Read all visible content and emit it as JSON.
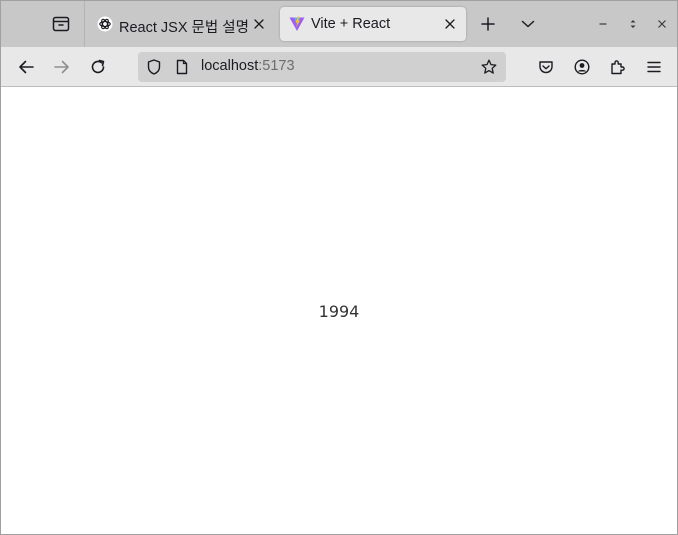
{
  "tabs": [
    {
      "title": "React JSX 문법 설명",
      "favicon": "chatgpt-icon",
      "active": false
    },
    {
      "title": "Vite + React",
      "favicon": "vite-icon",
      "active": true
    }
  ],
  "urlbar": {
    "host": "localhost",
    "port": ":5173"
  },
  "page": {
    "text": "1994"
  },
  "colors": {
    "tabstrip_bg": "#c8c8c8",
    "toolbar_bg": "#e8e8e8",
    "urlbar_bg": "#d0d0d0",
    "vite_purple": "#9f5cf2",
    "vite_yellow": "#ffc517"
  }
}
